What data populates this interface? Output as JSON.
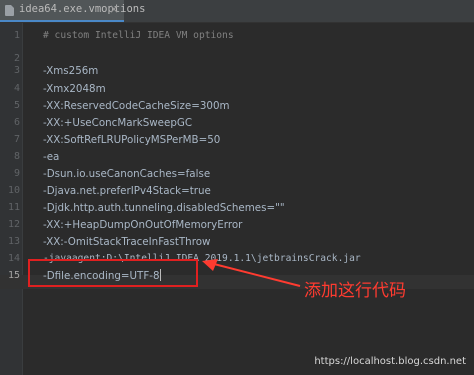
{
  "tab": {
    "file_icon": "file-icon",
    "label": "idea64.exe.vmoptions",
    "close": "×"
  },
  "editor": {
    "lines": [
      {
        "num": "1",
        "text": "# custom IntelliJ IDEA VM options"
      },
      {
        "num": "2",
        "text": ""
      },
      {
        "num": "3",
        "text": "-Xms256m"
      },
      {
        "num": "4",
        "text": "-Xmx2048m"
      },
      {
        "num": "5",
        "text": "-XX:ReservedCodeCacheSize=300m"
      },
      {
        "num": "6",
        "text": "-XX:+UseConcMarkSweepGC"
      },
      {
        "num": "7",
        "text": "-XX:SoftRefLRUPolicyMSPerMB=50"
      },
      {
        "num": "8",
        "text": "-ea"
      },
      {
        "num": "9",
        "text": "-Dsun.io.useCanonCaches=false"
      },
      {
        "num": "10",
        "text": "-Djava.net.preferIPv4Stack=true"
      },
      {
        "num": "11",
        "text": "-Djdk.http.auth.tunneling.disabledSchemes=\"\""
      },
      {
        "num": "12",
        "text": "-XX:+HeapDumpOnOutOfMemoryError"
      },
      {
        "num": "13",
        "text": "-XX:-OmitStackTraceInFastThrow"
      },
      {
        "num": "14",
        "text": "-javaagent:D:\\IntelliJ IDEA 2019.1.1\\jetbrainsCrack.jar"
      },
      {
        "num": "15",
        "text": "-Dfile.encoding=UTF-8"
      }
    ],
    "active_line": "15"
  },
  "annotation": {
    "text": "添加这行代码",
    "color": "#ff3b30"
  },
  "watermark": "https://localhost.blog.csdn.net",
  "colors": {
    "background": "#2b2b2b",
    "gutter": "#313335",
    "line_number": "#606366",
    "code_text": "#a9b7c6",
    "comment": "#808080",
    "tab_accent": "#4a88c7",
    "highlight_box": "#e02020"
  }
}
